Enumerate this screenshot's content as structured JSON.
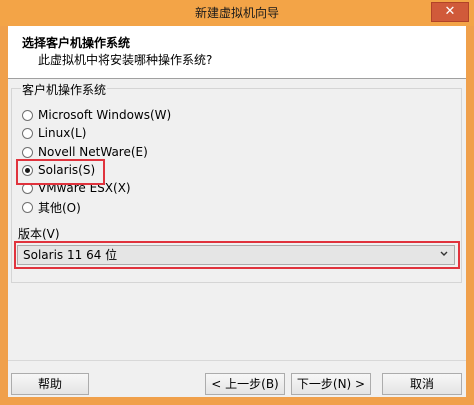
{
  "window": {
    "title": "新建虚拟机向导",
    "close_glyph": "✕"
  },
  "header": {
    "title": "选择客户机操作系统",
    "subtitle": "此虚拟机中将安装哪种操作系统?"
  },
  "os_group": {
    "label": "客户机操作系统",
    "options": [
      {
        "label": "Microsoft Windows(W)",
        "checked": false
      },
      {
        "label": "Linux(L)",
        "checked": false
      },
      {
        "label": "Novell NetWare(E)",
        "checked": false
      },
      {
        "label": "Solaris(S)",
        "checked": true
      },
      {
        "label": "VMware ESX(X)",
        "checked": false
      },
      {
        "label": "其他(O)",
        "checked": false
      }
    ]
  },
  "version": {
    "label": "版本(V)",
    "selected": "Solaris 11 64 位"
  },
  "buttons": {
    "help": "帮助",
    "back": "< 上一步(B)",
    "next": "下一步(N) >",
    "cancel": "取消"
  },
  "colors": {
    "titlebar": "#f3a447",
    "highlight": "#e0333d"
  }
}
